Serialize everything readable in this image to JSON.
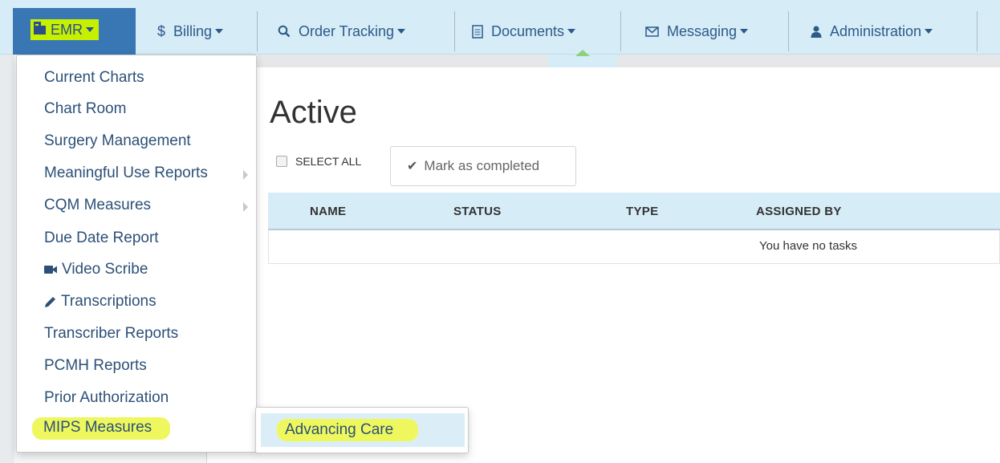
{
  "navbar": {
    "emr": {
      "label": "EMR",
      "icon": "chart-file-icon"
    },
    "items": [
      {
        "label": "Billing",
        "icon": "dollar-icon"
      },
      {
        "label": "Order Tracking",
        "icon": "search-icon"
      },
      {
        "label": "Documents",
        "icon": "document-icon"
      },
      {
        "label": "Messaging",
        "icon": "envelope-icon"
      },
      {
        "label": "Administration",
        "icon": "user-icon"
      }
    ]
  },
  "emr_menu": {
    "items": [
      {
        "label": "Current Charts"
      },
      {
        "label": "Chart Room"
      },
      {
        "label": "Surgery Management"
      },
      {
        "label": "Meaningful Use Reports",
        "has_submenu": true
      },
      {
        "label": "CQM Measures",
        "has_submenu": true
      },
      {
        "label": "Due Date Report"
      },
      {
        "label": "Video Scribe",
        "icon": "video-camera-icon"
      },
      {
        "label": "Transcriptions",
        "icon": "pencil-icon"
      },
      {
        "label": "Transcriber Reports"
      },
      {
        "label": "PCMH Reports"
      },
      {
        "label": "Prior Authorization"
      }
    ],
    "highlighted": {
      "label": "MIPS Measures"
    }
  },
  "mips_submenu": {
    "items": [
      {
        "label": "Advancing Care"
      }
    ]
  },
  "main": {
    "title": "Active",
    "select_all_label": "SELECT ALL",
    "mark_completed_label": "Mark as completed",
    "table": {
      "columns": [
        "NAME",
        "STATUS",
        "TYPE",
        "ASSIGNED BY"
      ],
      "empty_message": "You have no tasks"
    }
  },
  "colors": {
    "navbar_bg": "#d6ecf7",
    "active_tab_bg": "#3876b4",
    "highlight": "#eef85e",
    "link": "#2c5078"
  }
}
